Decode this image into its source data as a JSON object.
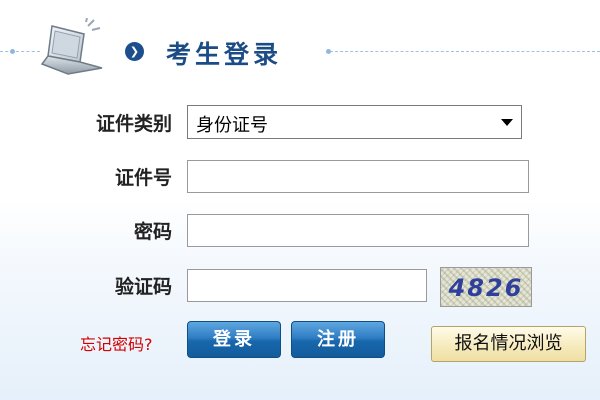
{
  "header": {
    "title": "考生登录",
    "bullet_icon": "circle-arrow-right-icon",
    "illustration_icon": "laptop-icon"
  },
  "form": {
    "id_type": {
      "label": "证件类别",
      "selected": "身份证号",
      "icon": "chevron-down-icon"
    },
    "id_number": {
      "label": "证件号",
      "value": ""
    },
    "password": {
      "label": "密码",
      "value": ""
    },
    "captcha": {
      "label": "验证码",
      "value": "",
      "image_text": "4826"
    }
  },
  "actions": {
    "forgot_password": "忘记密码?",
    "login": "登录",
    "register": "注册",
    "browse_registration": "报名情况浏览"
  },
  "colors": {
    "title": "#1c4c86",
    "primary_button": "#1867ac",
    "forgot_link": "#d50000",
    "secondary_button": "#f6ebbe"
  }
}
